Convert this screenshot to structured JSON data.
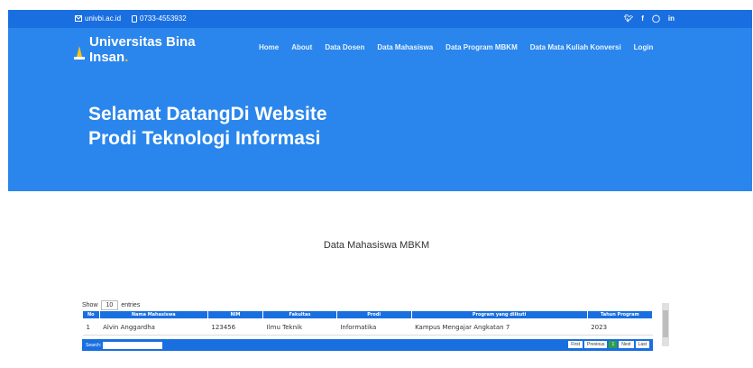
{
  "topbar": {
    "email": "univbi.ac.id",
    "phone": "0733-4553932"
  },
  "brand": {
    "line1": "Universitas Bina",
    "line2": "Insan",
    "dot": "."
  },
  "nav": [
    "Home",
    "About",
    "Data Dosen",
    "Data Mahasiswa",
    "Data Program MBKM",
    "Data Mata Kuliah Konversi",
    "Login"
  ],
  "hero": {
    "line1": "Selamat DatangDi Website",
    "line2": "Prodi Teknologi Informasi"
  },
  "section_title": "Data Mahasiswa MBKM",
  "table": {
    "show_label": "Show",
    "length": "10",
    "entries_label": "entries",
    "headers": [
      "No",
      "Nama Mahasiswa",
      "NIM",
      "Fakultas",
      "Prodi",
      "Program yang diikuti",
      "Tahun Program"
    ],
    "rows": [
      [
        "1",
        "Alvin Anggardha",
        "123456",
        "Ilmu Teknik",
        "Informatika",
        "Kampus Mengajar Angkatan 7",
        "2023"
      ]
    ],
    "search_label": "Search:",
    "pager": [
      "First",
      "Previous",
      "1",
      "Next",
      "Last"
    ]
  }
}
